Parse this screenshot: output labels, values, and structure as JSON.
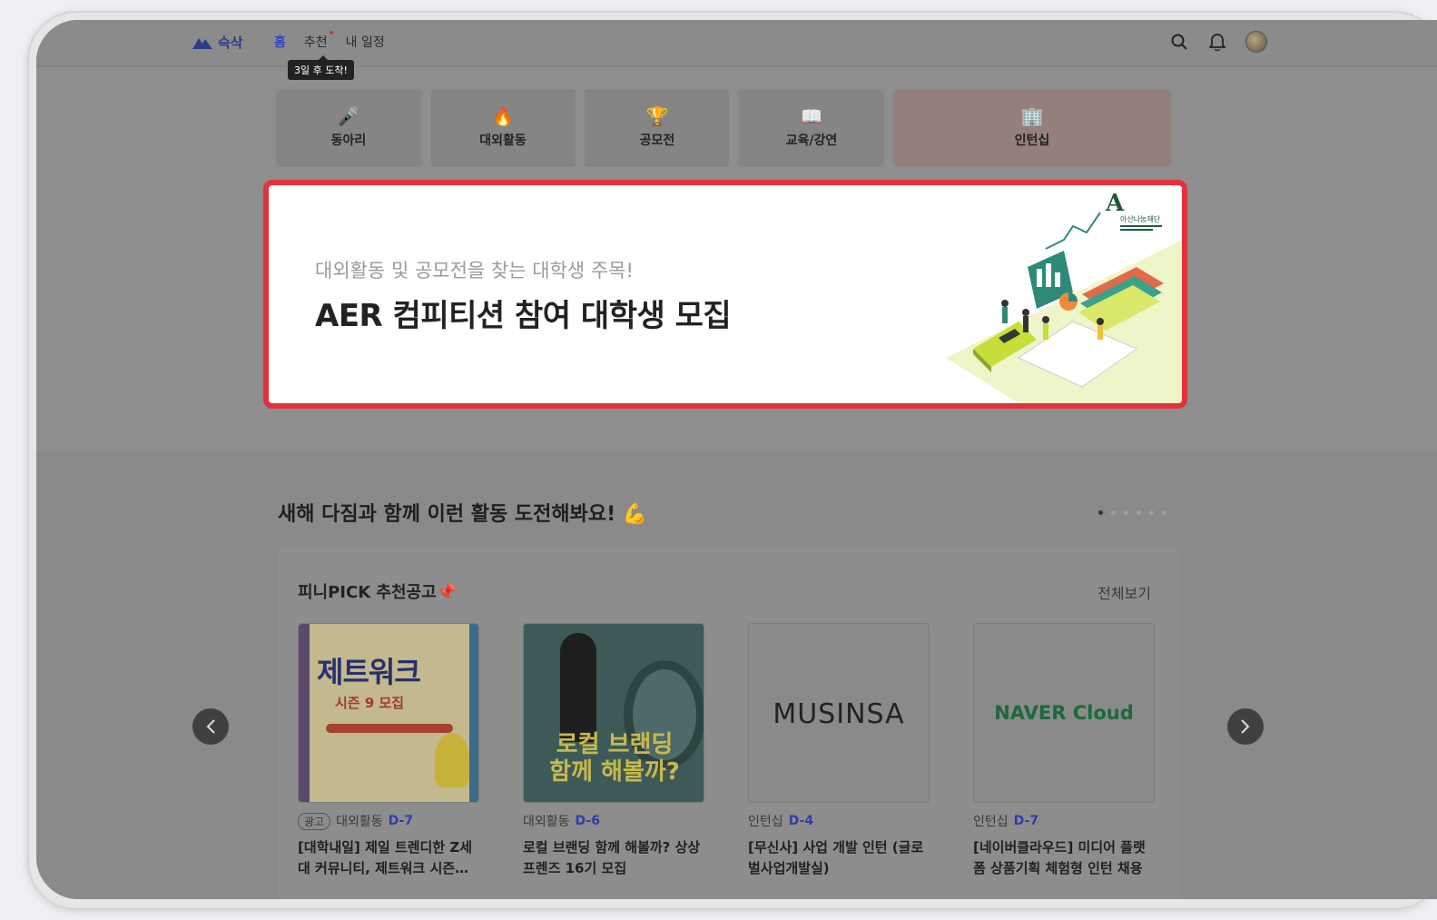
{
  "header": {
    "logo_text": "슥삭",
    "nav": [
      "홈",
      "추천",
      "내 일정"
    ],
    "tooltip": "3일 후 도착!"
  },
  "categories": [
    {
      "label": "동아리",
      "icon": "microphone-icon",
      "glyph": "🎤"
    },
    {
      "label": "대외활동",
      "icon": "fire-icon",
      "glyph": "🔥"
    },
    {
      "label": "공모전",
      "icon": "trophy-icon",
      "glyph": "🏆"
    },
    {
      "label": "교육/강연",
      "icon": "book-icon",
      "glyph": "📖"
    },
    {
      "label": "인턴십",
      "icon": "building-icon",
      "glyph": "🏢"
    }
  ],
  "banner": {
    "subtitle": "대외활동 및 공모전을 찾는 대학생 주목!",
    "title": "AER 컴피티션 참여 대학생 모집",
    "sponsor_logo": "아산나눔재단"
  },
  "section": {
    "title": "새해 다짐과 함께  이런 활동 도전해봐요! 💪",
    "panel_title": "피니PICK 추천공고📌",
    "see_all": "전체보기"
  },
  "cards": [
    {
      "ad": "광고",
      "category": "대외활동",
      "dday": "D-7",
      "title": "[대학내일] 제일 트렌디한 Z세대 커뮤니티, 제트워크 시즌…",
      "thumb_text": "제트워크",
      "thumb_sub": "시즌 9 모집"
    },
    {
      "ad": "",
      "category": "대외활동",
      "dday": "D-6",
      "title": "로컬 브랜딩 함께 해볼까? 상상프렌즈 16기 모집",
      "thumb_text": "로컬 브랜딩",
      "thumb_sub": "함께 해볼까?"
    },
    {
      "ad": "",
      "category": "인턴십",
      "dday": "D-4",
      "title": "[무신사] 사업 개발 인턴 (글로벌사업개발실)",
      "thumb_text": "MUSINSA",
      "thumb_sub": ""
    },
    {
      "ad": "",
      "category": "인턴십",
      "dday": "D-7",
      "title": "[네이버클라우드] 미디어 플랫폼 상품기획 체험형 인턴 채용",
      "thumb_text": "NAVER Cloud",
      "thumb_sub": ""
    }
  ],
  "colors": {
    "accent": "#2f45b8",
    "highlight": "#e3323a",
    "naver": "#03c75a"
  }
}
